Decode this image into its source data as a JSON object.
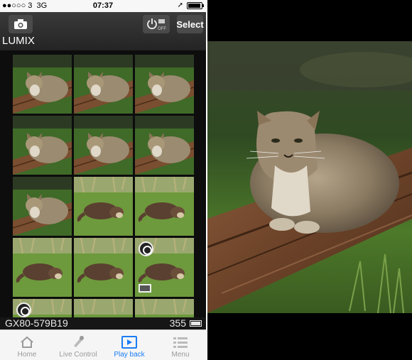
{
  "status_bar": {
    "carrier": "●●○○○ 3",
    "network": "3G",
    "time": "07:37"
  },
  "app_bar": {
    "brand": "LUMIX",
    "select_label": "Select",
    "power_sub": "OFF"
  },
  "thumbnails": [
    {
      "kind": "cat"
    },
    {
      "kind": "cat"
    },
    {
      "kind": "cat"
    },
    {
      "kind": "cat"
    },
    {
      "kind": "cat"
    },
    {
      "kind": "cat"
    },
    {
      "kind": "cat"
    },
    {
      "kind": "otter"
    },
    {
      "kind": "otter"
    },
    {
      "kind": "otter"
    },
    {
      "kind": "otter"
    },
    {
      "kind": "otter",
      "badge": true,
      "stack": true
    },
    {
      "kind": "otter",
      "badge": true
    },
    {
      "kind": "otter"
    },
    {
      "kind": "otter"
    }
  ],
  "info_bar": {
    "model": "GX80-579B19",
    "count": "355"
  },
  "tabs": [
    {
      "label": "Home",
      "icon": "house-icon"
    },
    {
      "label": "Live Control",
      "icon": "pen-icon"
    },
    {
      "label": "Play back",
      "icon": "play-icon"
    },
    {
      "label": "Menu",
      "icon": "list-icon"
    }
  ],
  "colors": {
    "accent": "#1a7cf5",
    "bar": "#2c2c2c"
  }
}
